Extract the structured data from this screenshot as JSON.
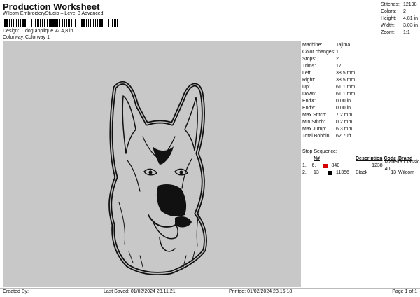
{
  "header": {
    "title": "Production Worksheet",
    "subtitle": "Wilcom EmbroideryStudio – Level 3 Advanced"
  },
  "design_info": [
    {
      "label": "Design:",
      "value": "dog applique v2 4,8 in"
    },
    {
      "label": "Colorway:",
      "value": "Colorway 1"
    }
  ],
  "stats_top": [
    {
      "label": "Stitches:",
      "value": "12198"
    },
    {
      "label": "Colors:",
      "value": "2"
    },
    {
      "label": "Height:",
      "value": "4.81 in"
    },
    {
      "label": "Width:",
      "value": "3.03 in"
    },
    {
      "label": "Zoom:",
      "value": "1:1"
    }
  ],
  "machine_info": [
    {
      "label": "Machine:",
      "value": "Tajima"
    },
    {
      "label": "Color changes:",
      "value": "1"
    },
    {
      "label": "Stops:",
      "value": "2"
    },
    {
      "label": "Trims:",
      "value": "17"
    },
    {
      "label": "Left:",
      "value": "38.5 mm"
    },
    {
      "label": "Right:",
      "value": "38.5 mm"
    },
    {
      "label": "Up:",
      "value": "61.1 mm"
    },
    {
      "label": "Down:",
      "value": "61.1 mm"
    },
    {
      "label": "EndX:",
      "value": "0.00 in"
    },
    {
      "label": "EndY:",
      "value": "0.00 in"
    },
    {
      "label": "Max Stitch:",
      "value": "7.2 mm"
    },
    {
      "label": "Min Stitch:",
      "value": "0.2 mm"
    },
    {
      "label": "Max Jump:",
      "value": "6.3 mm"
    },
    {
      "label": "Total Bobbin:",
      "value": "62.70ft"
    }
  ],
  "stop_sequence": {
    "title": "Stop Sequence:",
    "headers": {
      "n": "N#",
      "description": "Description",
      "code": "Code",
      "brand": "Brand"
    },
    "rows": [
      {
        "idx": "1.",
        "n": "6.",
        "color": "#d40000",
        "code_num": "840",
        "description": "",
        "code": "1238",
        "brand": "Madeira Classic 40"
      },
      {
        "idx": "2.",
        "n": "13",
        "color": "#000000",
        "code_num": "11356",
        "description": "Black",
        "code": "13",
        "brand": "Wilcom"
      }
    ]
  },
  "footer": {
    "created_by": "Created By:",
    "last_saved": "Last Saved: 01/02/2024 23.11.21",
    "printed": "Printed: 01/02/2024 23.16.18",
    "page": "Page 1 of 1"
  },
  "colors": {
    "design_bg": "#c8c8c8",
    "thread_1": "#d40000",
    "thread_2": "#000000"
  }
}
